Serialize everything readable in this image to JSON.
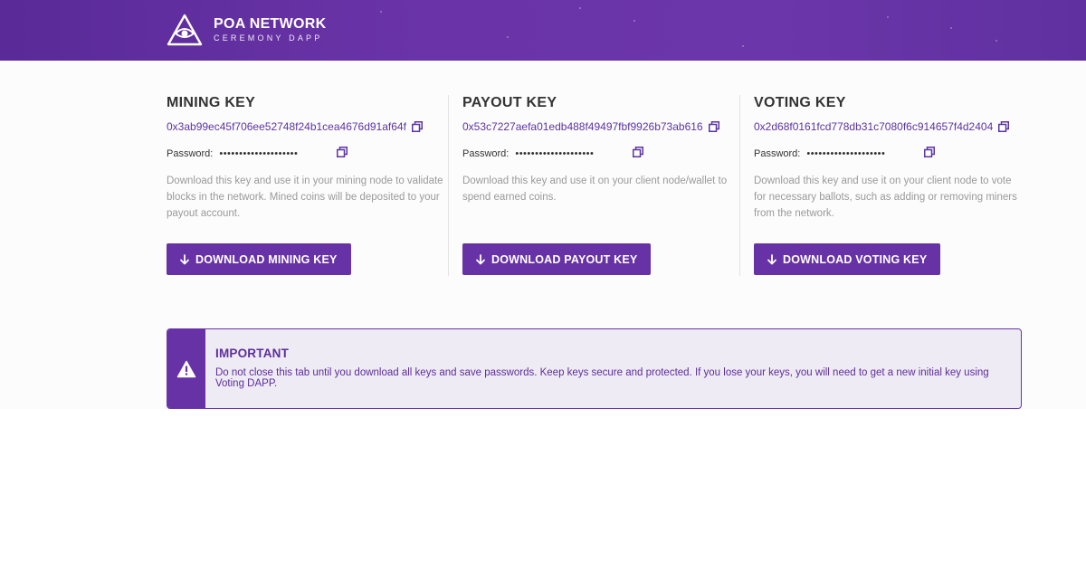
{
  "header": {
    "title": "POA NETWORK",
    "subtitle": "CEREMONY DAPP",
    "logo_icon": "eye-triangle-icon"
  },
  "keys": [
    {
      "title": "MINING KEY",
      "address": "0x3ab99ec45f706ee52748f24b1cea4676d91af64f",
      "password_label": "Password:",
      "password_dots": "••••••••••••••••••••",
      "description": "Download this key and use it in your mining node to validate blocks in the network. Mined coins will be deposited to your payout account.",
      "button_label": "DOWNLOAD MINING KEY"
    },
    {
      "title": "PAYOUT KEY",
      "address": "0x53c7227aefa01edb488f49497fbf9926b73ab616",
      "password_label": "Password:",
      "password_dots": "••••••••••••••••••••",
      "description": "Download this key and use it on your client node/wallet to spend earned coins.",
      "button_label": "DOWNLOAD PAYOUT KEY"
    },
    {
      "title": "VOTING KEY",
      "address": "0x2d68f0161fcd778db31c7080f6c914657f4d2404",
      "password_label": "Password:",
      "password_dots": "••••••••••••••••••••",
      "description": "Download this key and use it on your client node to vote for necessary ballots, such as adding or removing miners from the network.",
      "button_label": "DOWNLOAD VOTING KEY"
    }
  ],
  "notice": {
    "title": "IMPORTANT",
    "text": "Do not close this tab until you download all keys and save passwords. Keep keys secure and protected. If you lose your keys, you will need to get a new initial key using Voting DAPP.",
    "icon": "warning-icon"
  },
  "colors": {
    "brand_purple": "#6732a6",
    "notice_bg": "#efebf4",
    "link_purple": "#5c34a2"
  }
}
